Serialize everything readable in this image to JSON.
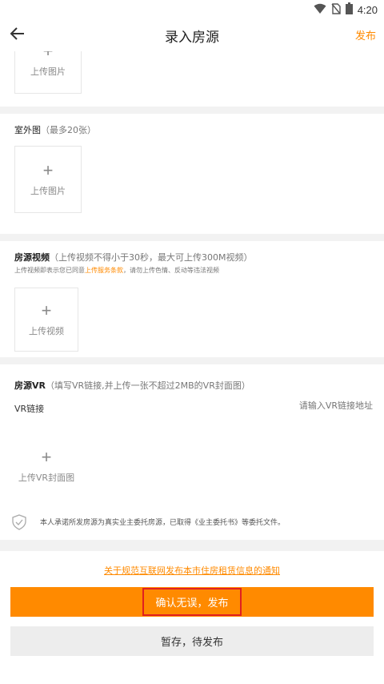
{
  "statusbar": {
    "time": "4:20"
  },
  "header": {
    "title": "录入房源",
    "publish_label": "发布"
  },
  "upload": {
    "plus": "+",
    "image_label": "上传图片",
    "video_label": "上传视频",
    "vr_cover_label": "上传VR封面图"
  },
  "exterior": {
    "title": "室外图",
    "hint": "（最多20张）"
  },
  "video": {
    "title": "房源视频",
    "hint": "（上传视频不得小于30秒，最大可上传300M视频）",
    "note_prefix": "上传视频即表示您已同意",
    "note_link": "上传服务条款",
    "note_suffix": "，请勿上传色情、反动等违法视频"
  },
  "vr": {
    "title": "房源VR",
    "hint": "（填写VR链接,并上传一张不超过2MB的VR封面图）",
    "link_label": "VR链接",
    "link_placeholder": "请输入VR链接地址"
  },
  "promise": {
    "text": "本人承诺所发房源为真实业主委托房源，已取得《业主委托书》等委托文件。"
  },
  "footer": {
    "notice_link": "关于规范互联网发布本市住房租赁信息的通知",
    "confirm_label": "确认无误，发布",
    "draft_label": "暂存，待发布"
  },
  "colors": {
    "accent": "#ff8a00",
    "highlight_border": "#e02020"
  }
}
